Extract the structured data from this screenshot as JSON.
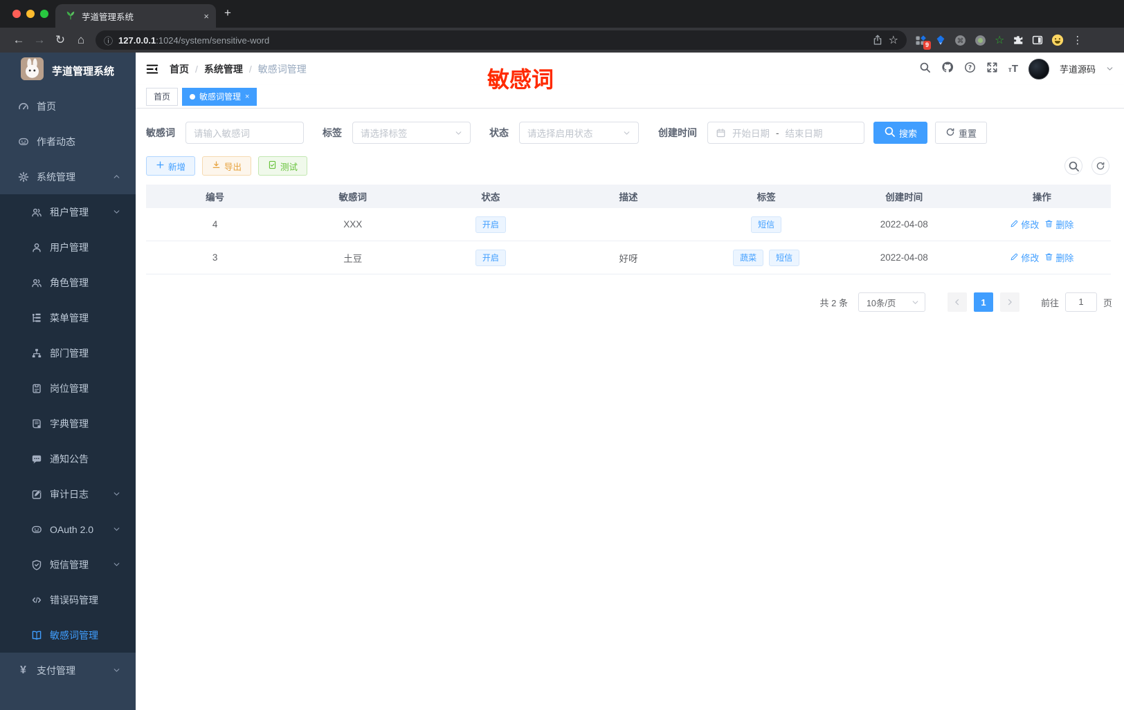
{
  "browser": {
    "tab_title": "芋道管理系统",
    "new_tab_label": "+",
    "tab_close_label": "×",
    "url_host": "127.0.0.1",
    "url_rest": ":1024/system/sensitive-word",
    "extension_badge": "9",
    "kebab": "⋮"
  },
  "sidebar": {
    "logo_title": "芋道管理系统",
    "items": [
      {
        "key": "home",
        "label": "首页",
        "icon": "gauge",
        "level": 1
      },
      {
        "key": "author-feed",
        "label": "作者动态",
        "icon": "chat",
        "level": 1
      },
      {
        "key": "system",
        "label": "系统管理",
        "icon": "gear",
        "level": 1,
        "chevron": "up"
      },
      {
        "key": "tenant",
        "label": "租户管理",
        "icon": "users",
        "level": 2,
        "chevron": "down"
      },
      {
        "key": "user",
        "label": "用户管理",
        "icon": "user",
        "level": 2
      },
      {
        "key": "role",
        "label": "角色管理",
        "icon": "users",
        "level": 2
      },
      {
        "key": "menu",
        "label": "菜单管理",
        "icon": "tree",
        "level": 2
      },
      {
        "key": "dept",
        "label": "部门管理",
        "icon": "org",
        "level": 2
      },
      {
        "key": "post",
        "label": "岗位管理",
        "icon": "badge",
        "level": 2
      },
      {
        "key": "dict",
        "label": "字典管理",
        "icon": "book",
        "level": 2
      },
      {
        "key": "notice",
        "label": "通知公告",
        "icon": "comment",
        "level": 2
      },
      {
        "key": "audit-log",
        "label": "审计日志",
        "icon": "edit-note",
        "level": 2,
        "chevron": "down"
      },
      {
        "key": "oauth2",
        "label": "OAuth 2.0",
        "icon": "chat",
        "level": 2,
        "chevron": "down"
      },
      {
        "key": "sms",
        "label": "短信管理",
        "icon": "shield-check",
        "level": 2,
        "chevron": "down"
      },
      {
        "key": "error-code",
        "label": "错误码管理",
        "icon": "code",
        "level": 2
      },
      {
        "key": "sensitive-word",
        "label": "敏感词管理",
        "icon": "open-book",
        "level": 2,
        "active": true
      },
      {
        "key": "pay",
        "label": "支付管理",
        "icon": "yen",
        "level": 1,
        "chevron": "down"
      }
    ]
  },
  "header": {
    "breadcrumb": [
      "首页",
      "系统管理",
      "敏感词管理"
    ],
    "separator": "/",
    "username": "芋道源码"
  },
  "annotation": {
    "text": "敏感词",
    "color": "#ff2a00"
  },
  "tags_view": {
    "tabs": [
      {
        "label": "首页",
        "active": false,
        "closable": false
      },
      {
        "label": "敏感词管理",
        "active": true,
        "closable": true
      }
    ],
    "close_label": "×"
  },
  "filters": {
    "keyword": {
      "label": "敏感词",
      "placeholder": "请输入敏感词",
      "value": ""
    },
    "tag": {
      "label": "标签",
      "placeholder": "请选择标签"
    },
    "status": {
      "label": "状态",
      "placeholder": "请选择启用状态"
    },
    "create_time": {
      "label": "创建时间",
      "start_placeholder": "开始日期",
      "separator": "-",
      "end_placeholder": "结束日期"
    },
    "search_label": "搜索",
    "reset_label": "重置"
  },
  "toolbar": {
    "add_label": "新增",
    "export_label": "导出",
    "test_label": "测试"
  },
  "table": {
    "columns": [
      "编号",
      "敏感词",
      "状态",
      "描述",
      "标签",
      "创建时间",
      "操作"
    ],
    "edit_label": "修改",
    "delete_label": "删除",
    "rows": [
      {
        "id": "4",
        "word": "XXX",
        "status": "开启",
        "description": "",
        "tags": [
          "短信"
        ],
        "create_time": "2022-04-08"
      },
      {
        "id": "3",
        "word": "土豆",
        "status": "开启",
        "description": "好呀",
        "tags": [
          "蔬菜",
          "短信"
        ],
        "create_time": "2022-04-08"
      }
    ]
  },
  "pagination": {
    "total_text": "共 2 条",
    "page_size": "10条/页",
    "current_page": "1",
    "goto_label": "前往",
    "goto_value": "1",
    "page_suffix": "页"
  },
  "colors": {
    "primary": "#409eff",
    "annotation_red": "#ff2a00",
    "sidebar_bg": "#304156",
    "submenu_bg": "#1f2d3d",
    "warning": "#e6a23c",
    "success": "#67c23a"
  }
}
